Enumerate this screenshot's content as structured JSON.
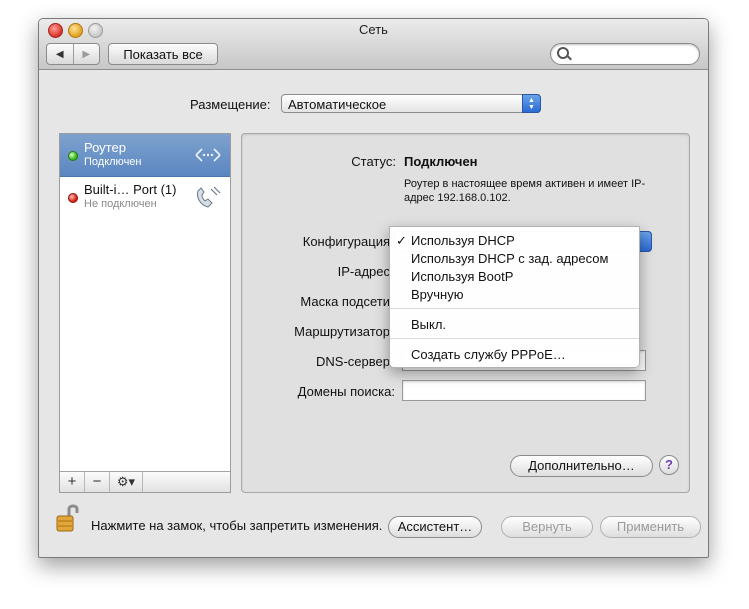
{
  "window": {
    "title": "Сеть"
  },
  "toolbar": {
    "show_all_label": "Показать все",
    "search_placeholder": ""
  },
  "location": {
    "label": "Размещение:",
    "value": "Автоматическое"
  },
  "services": [
    {
      "name": "Роутер",
      "status": "Подключен",
      "state_color": "#34b516"
    },
    {
      "name": "Built-i… Port (1)",
      "status": "Не подключен",
      "state_color": "#d81d10"
    }
  ],
  "sidebar_controls": {
    "add": "+",
    "remove": "−",
    "gear": "⚙▾"
  },
  "detail": {
    "status_label": "Статус:",
    "status_value": "Подключен",
    "status_desc": "Роутер в настоящее время активен и имеет IP-адрес 192.168.0.102.",
    "config_label": "Конфигурация",
    "ip_label": "IP-адрес",
    "mask_label": "Маска подсети",
    "router_label": "Маршрутизатор",
    "dns_label": "DNS-сервер",
    "search_domains_label": "Домены поиска:",
    "advanced_label": "Дополнительно…",
    "help_label": "?"
  },
  "config_menu": {
    "checked_mark": "✓",
    "items": [
      "Используя DHCP",
      "Используя DHCP с зад. адресом",
      "Используя BootP",
      "Вручную"
    ],
    "off_item": "Выкл.",
    "pppoe_item": "Создать службу PPPoE…"
  },
  "footer": {
    "lock_text": "Нажмите на замок, чтобы запретить изменения.",
    "assistant_label": "Ассистент…",
    "revert_label": "Вернуть",
    "apply_label": "Применить"
  },
  "colors": {
    "accent": "#2a6bd6",
    "selection": "#6a93c9"
  }
}
